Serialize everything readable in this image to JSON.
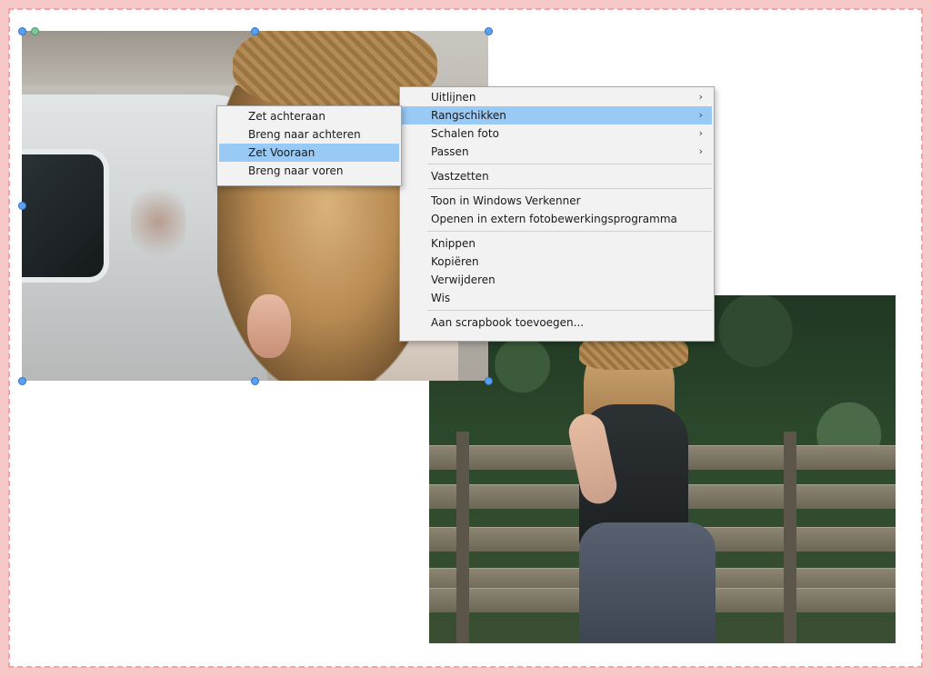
{
  "context_menu": {
    "items": [
      {
        "label": "Uitlijnen",
        "arrow": "›"
      },
      {
        "label": "Rangschikken",
        "arrow": "›"
      },
      {
        "label": "Schalen foto",
        "arrow": "›"
      },
      {
        "label": "Passen",
        "arrow": "›"
      },
      {
        "label": "Vastzetten"
      },
      {
        "label": "Toon in Windows Verkenner"
      },
      {
        "label": "Openen in extern fotobewerkingsprogramma"
      },
      {
        "label": "Knippen"
      },
      {
        "label": "Kopiëren"
      },
      {
        "label": "Verwijderen"
      },
      {
        "label": "Wis"
      },
      {
        "label": "Aan scrapbook toevoegen..."
      }
    ]
  },
  "submenu_rangschikken": {
    "items": [
      {
        "label": "Zet achteraan"
      },
      {
        "label": "Breng naar achteren"
      },
      {
        "label": "Zet Vooraan"
      },
      {
        "label": "Breng naar voren"
      }
    ]
  },
  "colors": {
    "page_background": "#f6c8c8",
    "page_dash_border": "#f3a3a3",
    "menu_highlight": "#99c9f5",
    "selection_handle": "#5aa0f0"
  }
}
